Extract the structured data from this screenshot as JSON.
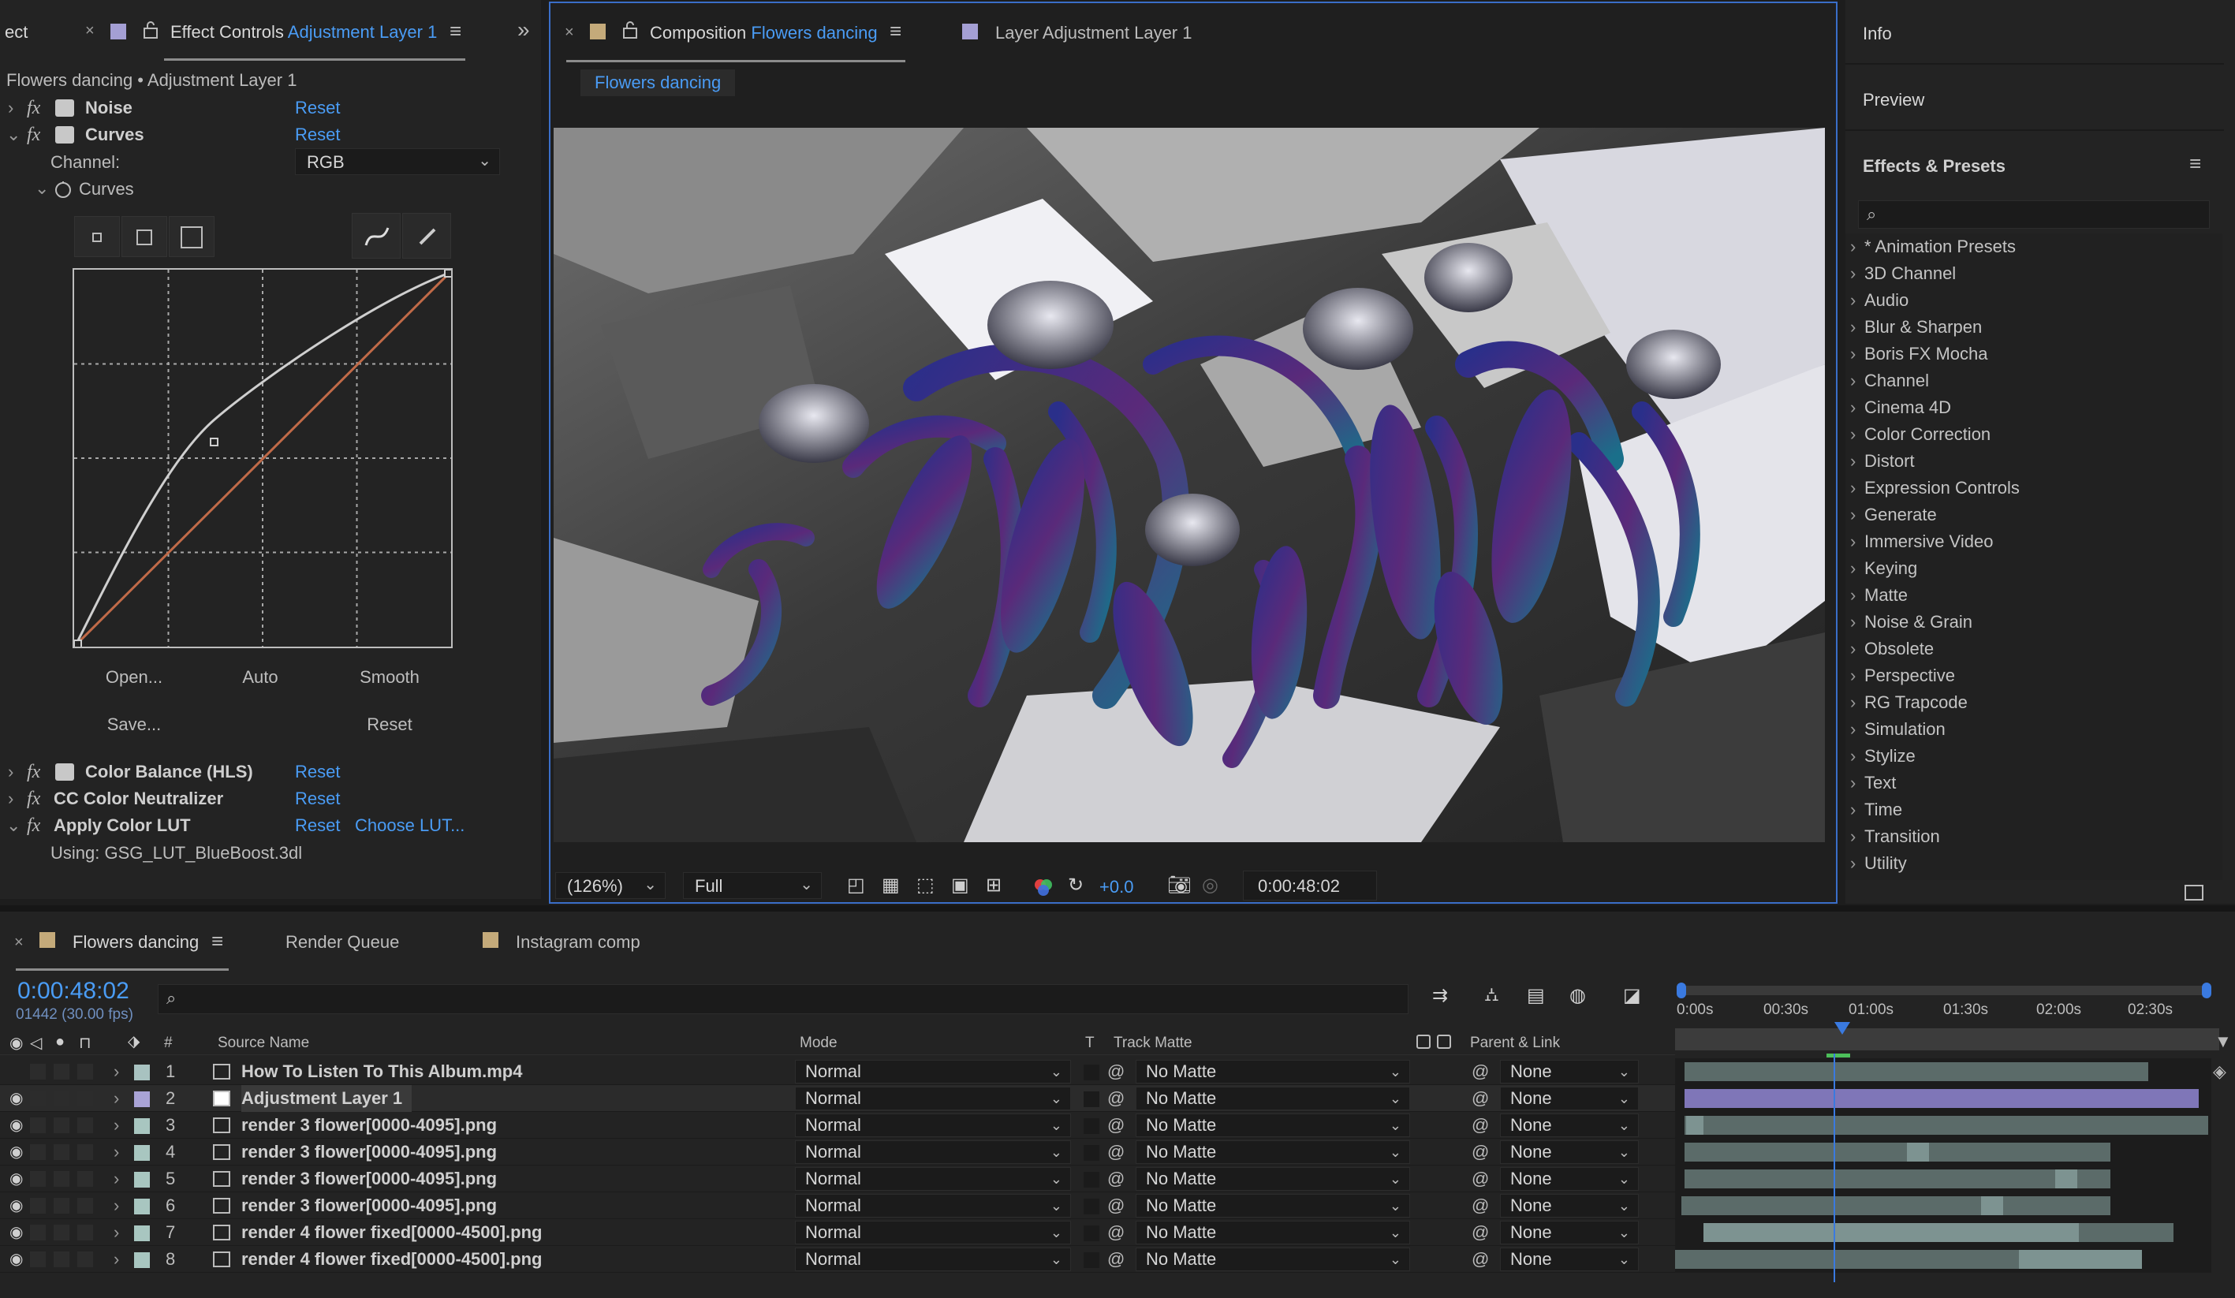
{
  "left_panel": {
    "cut_tab": "ect",
    "tab_label": "Effect Controls",
    "tab_layer": "Adjustment Layer 1",
    "breadcrumb": "Flowers dancing • Adjustment Layer 1",
    "effects": [
      {
        "name": "Noise",
        "reset": "Reset"
      },
      {
        "name": "Curves",
        "reset": "Reset"
      }
    ],
    "channel_label": "Channel:",
    "channel_value": "RGB",
    "curves_label": "Curves",
    "curve_buttons": {
      "open": "Open...",
      "auto": "Auto",
      "smooth": "Smooth",
      "save": "Save...",
      "reset": "Reset"
    },
    "effects_after": [
      {
        "name": "Color Balance (HLS)",
        "reset": "Reset"
      },
      {
        "name": "CC Color Neutralizer",
        "reset": "Reset"
      },
      {
        "name": "Apply Color LUT",
        "reset": "Reset",
        "extra": "Choose LUT..."
      }
    ],
    "lut_using": "Using: GSG_LUT_BlueBoost.3dl"
  },
  "comp_panel": {
    "tab_label": "Composition",
    "tab_comp": "Flowers dancing",
    "tab2_label": "Layer Adjustment Layer 1",
    "sub_tab": "Flowers dancing",
    "zoom": "(126%)",
    "resolution": "Full",
    "exposure": "+0.0",
    "timecode": "0:00:48:02"
  },
  "right_panel": {
    "info": "Info",
    "preview": "Preview",
    "effects_presets": "Effects & Presets",
    "search_placeholder": "",
    "categories": [
      "* Animation Presets",
      "3D Channel",
      "Audio",
      "Blur & Sharpen",
      "Boris FX Mocha",
      "Channel",
      "Cinema 4D",
      "Color Correction",
      "Distort",
      "Expression Controls",
      "Generate",
      "Immersive Video",
      "Keying",
      "Matte",
      "Noise & Grain",
      "Obsolete",
      "Perspective",
      "RG Trapcode",
      "Simulation",
      "Stylize",
      "Text",
      "Time",
      "Transition",
      "Utility"
    ]
  },
  "timeline": {
    "tabs": [
      "Flowers dancing",
      "Render Queue",
      "Instagram comp"
    ],
    "timecode": "0:00:48:02",
    "frames": "01442 (30.00 fps)",
    "columns": {
      "num": "#",
      "source": "Source Name",
      "mode": "Mode",
      "t": "T",
      "track_matte": "Track Matte",
      "parent": "Parent & Link"
    },
    "ruler": [
      "0:00s",
      "00:30s",
      "01:00s",
      "01:30s",
      "02:00s",
      "02:30s"
    ],
    "layers": [
      {
        "num": "1",
        "name": "How To Listen To This Album.mp4",
        "mode": "Normal",
        "matte": "No Matte",
        "parent": "None",
        "color": "#a8c2c0"
      },
      {
        "num": "2",
        "name": "Adjustment Layer 1",
        "mode": "Normal",
        "matte": "No Matte",
        "parent": "None",
        "color": "#a9a3d6"
      },
      {
        "num": "3",
        "name": "render 3 flower[0000-4095].png",
        "mode": "Normal",
        "matte": "No Matte",
        "parent": "None",
        "color": "#a8c6c0"
      },
      {
        "num": "4",
        "name": "render 3 flower[0000-4095].png",
        "mode": "Normal",
        "matte": "No Matte",
        "parent": "None",
        "color": "#a8c6c0"
      },
      {
        "num": "5",
        "name": "render 3 flower[0000-4095].png",
        "mode": "Normal",
        "matte": "No Matte",
        "parent": "None",
        "color": "#a8c6c0"
      },
      {
        "num": "6",
        "name": "render 3 flower[0000-4095].png",
        "mode": "Normal",
        "matte": "No Matte",
        "parent": "None",
        "color": "#a8c6c0"
      },
      {
        "num": "7",
        "name": "render 4 flower fixed[0000-4500].png",
        "mode": "Normal",
        "matte": "No Matte",
        "parent": "None",
        "color": "#a8c6c0"
      },
      {
        "num": "8",
        "name": "render 4 flower fixed[0000-4500].png",
        "mode": "Normal",
        "matte": "No Matte",
        "parent": "None",
        "color": "#a8c6c0"
      }
    ]
  },
  "colors": {
    "accent": "#4a9cf5",
    "panel": "#232323",
    "bg": "#1d1d1d",
    "adjustment_bar": "#7f76b8",
    "bar": "#5b6b69"
  }
}
